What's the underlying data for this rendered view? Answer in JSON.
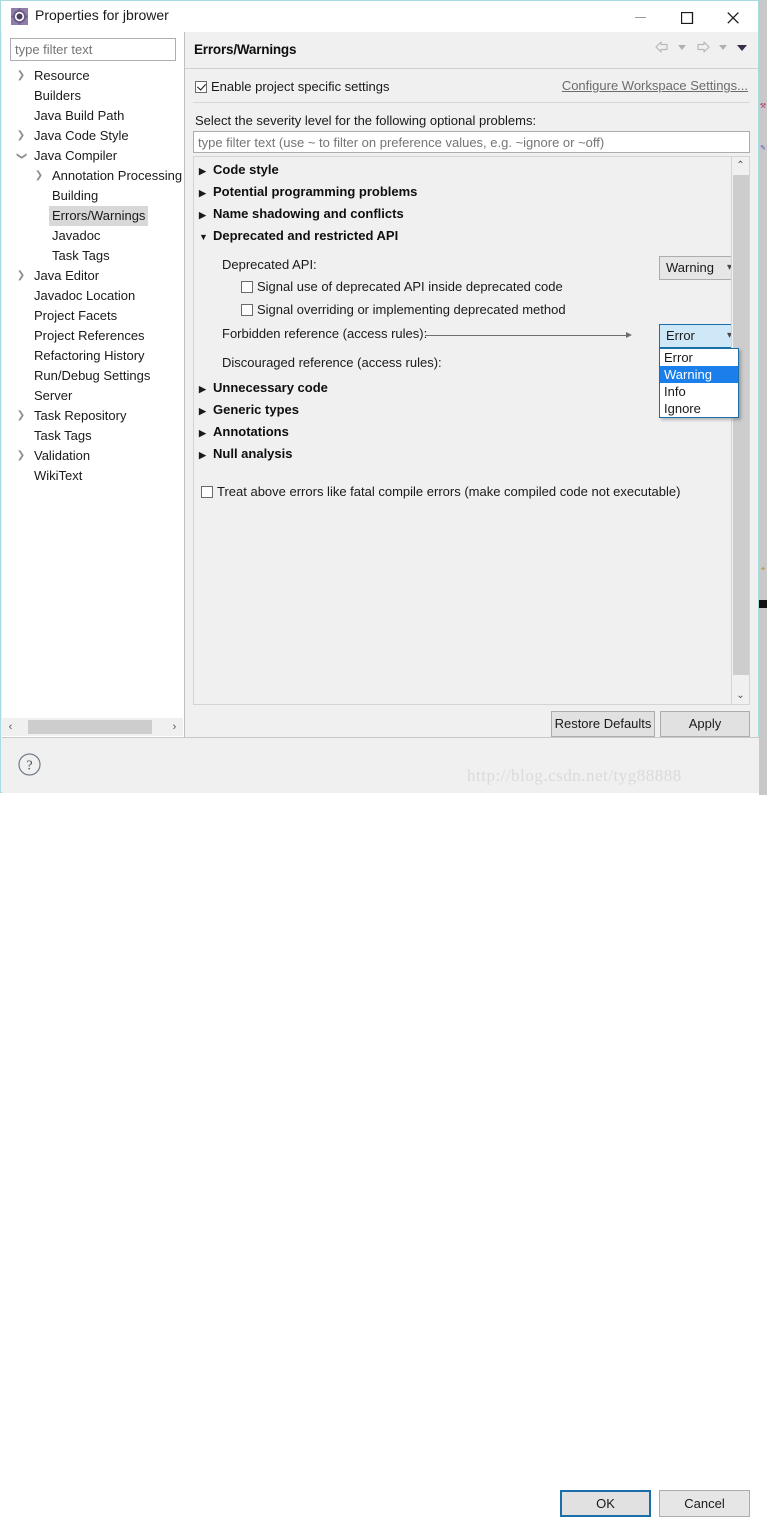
{
  "window": {
    "title": "Properties for jbrower",
    "icon": "properties-gear-icon",
    "minimize_label": "Minimize",
    "maximize_label": "Maximize",
    "close_label": "Close"
  },
  "sidebar": {
    "filter_placeholder": "type filter text",
    "filter_value": "",
    "items": [
      {
        "label": "Resource",
        "level": 1,
        "arrow": "collapsed",
        "selected": false
      },
      {
        "label": "Builders",
        "level": 1,
        "arrow": "none",
        "selected": false
      },
      {
        "label": "Java Build Path",
        "level": 1,
        "arrow": "none",
        "selected": false
      },
      {
        "label": "Java Code Style",
        "level": 1,
        "arrow": "collapsed",
        "selected": false
      },
      {
        "label": "Java Compiler",
        "level": 1,
        "arrow": "expanded",
        "selected": false
      },
      {
        "label": "Annotation Processing",
        "level": 2,
        "arrow": "collapsed",
        "selected": false
      },
      {
        "label": "Building",
        "level": 2,
        "arrow": "none",
        "selected": false
      },
      {
        "label": "Errors/Warnings",
        "level": 2,
        "arrow": "none",
        "selected": true
      },
      {
        "label": "Javadoc",
        "level": 2,
        "arrow": "none",
        "selected": false
      },
      {
        "label": "Task Tags",
        "level": 2,
        "arrow": "none",
        "selected": false
      },
      {
        "label": "Java Editor",
        "level": 1,
        "arrow": "collapsed",
        "selected": false
      },
      {
        "label": "Javadoc Location",
        "level": 1,
        "arrow": "none",
        "selected": false
      },
      {
        "label": "Project Facets",
        "level": 1,
        "arrow": "none",
        "selected": false
      },
      {
        "label": "Project References",
        "level": 1,
        "arrow": "none",
        "selected": false
      },
      {
        "label": "Refactoring History",
        "level": 1,
        "arrow": "none",
        "selected": false
      },
      {
        "label": "Run/Debug Settings",
        "level": 1,
        "arrow": "none",
        "selected": false
      },
      {
        "label": "Server",
        "level": 1,
        "arrow": "none",
        "selected": false
      },
      {
        "label": "Task Repository",
        "level": 1,
        "arrow": "collapsed",
        "selected": false
      },
      {
        "label": "Task Tags",
        "level": 1,
        "arrow": "none",
        "selected": false
      },
      {
        "label": "Validation",
        "level": 1,
        "arrow": "collapsed",
        "selected": false
      },
      {
        "label": "WikiText",
        "level": 1,
        "arrow": "none",
        "selected": false
      }
    ],
    "hscroll_left_label": "‹",
    "hscroll_right_label": "›"
  },
  "page": {
    "title": "Errors/Warnings",
    "nav": {
      "back_label": "Back",
      "back_menu_label": "Back history",
      "forward_label": "Forward",
      "forward_menu_label": "Forward history",
      "view_menu_label": "View menu"
    },
    "enable_specific": {
      "label": "Enable project specific settings",
      "checked": true
    },
    "configure_workspace_link": "Configure Workspace Settings...",
    "severity_intro": "Select the severity level for the following optional problems:",
    "options_filter_placeholder": "type filter text (use ~ to filter on preference values, e.g. ~ignore or ~off)",
    "options_filter_value": "",
    "groups": [
      {
        "label": "Code style",
        "expanded": false
      },
      {
        "label": "Potential programming problems",
        "expanded": false
      },
      {
        "label": "Name shadowing and conflicts",
        "expanded": false
      },
      {
        "label": "Deprecated and restricted API",
        "expanded": true
      }
    ],
    "deprecated_section": {
      "deprecated_api_label": "Deprecated API:",
      "deprecated_api_value": "Warning",
      "checkboxes": [
        {
          "label": "Signal use of deprecated API inside deprecated code",
          "checked": false
        },
        {
          "label": "Signal overriding or implementing deprecated method",
          "checked": false
        }
      ],
      "forbidden_label": "Forbidden reference (access rules):",
      "forbidden_value": "Error",
      "discouraged_label": "Discouraged reference (access rules):",
      "discouraged_value": ""
    },
    "dropdown": {
      "open": true,
      "options": [
        "Error",
        "Warning",
        "Info",
        "Ignore"
      ],
      "highlighted": "Warning"
    },
    "groups_after": [
      {
        "label": "Unnecessary code",
        "expanded": false
      },
      {
        "label": "Generic types",
        "expanded": false
      },
      {
        "label": "Annotations",
        "expanded": false
      },
      {
        "label": "Null analysis",
        "expanded": false
      }
    ],
    "fatal_checkbox": {
      "label": "Treat above errors like fatal compile errors (make compiled code not executable)",
      "checked": false
    },
    "scroll_up_label": "⌃",
    "scroll_down_label": "⌄",
    "restore_defaults_label": "Restore Defaults",
    "apply_label": "Apply"
  },
  "footer": {
    "help_label": "?",
    "ok_label": "OK",
    "cancel_label": "Cancel"
  },
  "watermark": "http://blog.csdn.net/tyg88888",
  "colors": {
    "dialog_border": "#a7dbe0",
    "selection_blue": "#1a7fea",
    "focus_blue": "#1a6fa8",
    "combo_open_bg": "#cfe8f7",
    "panel_bg": "#f0f0f0",
    "tree_selection": "#d8d8d8"
  }
}
